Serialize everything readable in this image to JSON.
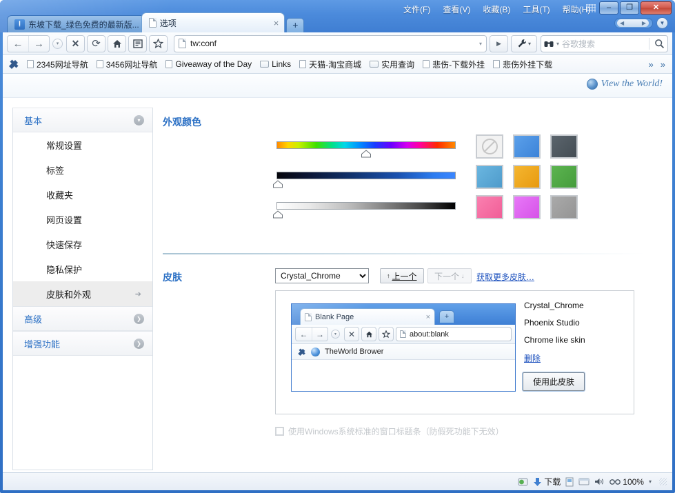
{
  "window": {
    "menus": [
      {
        "label": "文件(F)",
        "name": "menu-file"
      },
      {
        "label": "查看(V)",
        "name": "menu-view"
      },
      {
        "label": "收藏(B)",
        "name": "menu-favorites"
      },
      {
        "label": "工具(T)",
        "name": "menu-tools"
      },
      {
        "label": "帮助(H)",
        "name": "menu-help"
      }
    ],
    "controls": {
      "minimize": "–",
      "maximize": "❐",
      "close": "✕"
    }
  },
  "tabs": [
    {
      "label": "东坡下载_绿色免费的最新版...",
      "active": false,
      "icon": "tw-logo",
      "close": "×"
    },
    {
      "label": "选项",
      "active": true,
      "icon": "page-icon",
      "close": "×"
    }
  ],
  "new_tab_label": "+",
  "toolbar": {
    "back": "←",
    "forward": "→",
    "history_dropdown": "▾",
    "stop": "✕",
    "refresh": "⟳",
    "home": "⌂",
    "reader": "☰",
    "favorite": "☆",
    "address_value": "tw:conf",
    "address_dropdown": "▾",
    "go": "▶",
    "tools": "⚒",
    "tools_caret": "▾",
    "search_engine_icon": "☎",
    "search_caret": "▾",
    "search_placeholder": "谷歌搜索",
    "search_icon": "⌕"
  },
  "bookmarks": {
    "items": [
      {
        "label": "2345网址导航",
        "type": "doc"
      },
      {
        "label": "3456网址导航",
        "type": "doc"
      },
      {
        "label": "Giveaway of the Day",
        "type": "doc"
      },
      {
        "label": "Links",
        "type": "folder"
      },
      {
        "label": "天猫-淘宝商城",
        "type": "doc"
      },
      {
        "label": "实用查询",
        "type": "folder"
      },
      {
        "label": "悲伤-下载外挂",
        "type": "doc"
      },
      {
        "label": "悲伤外挂下载",
        "type": "doc"
      }
    ],
    "overflow1": "»",
    "overflow2": "»"
  },
  "brand": {
    "text": "View the World!"
  },
  "optnav": {
    "groups": [
      {
        "label": "基本",
        "name": "nav-group-basic",
        "expanded": true,
        "toggle_icon": "▾",
        "items": [
          {
            "label": "常规设置",
            "name": "sidebar-item-general",
            "selected": false
          },
          {
            "label": "标签",
            "name": "sidebar-item-tabs",
            "selected": false
          },
          {
            "label": "收藏夹",
            "name": "sidebar-item-favorites",
            "selected": false
          },
          {
            "label": "网页设置",
            "name": "sidebar-item-webpage",
            "selected": false
          },
          {
            "label": "快速保存",
            "name": "sidebar-item-quicksave",
            "selected": false
          },
          {
            "label": "隐私保护",
            "name": "sidebar-item-privacy",
            "selected": false
          },
          {
            "label": "皮肤和外观",
            "name": "sidebar-item-skin",
            "selected": true,
            "arrow": "➔"
          }
        ]
      },
      {
        "label": "高级",
        "name": "nav-group-advanced",
        "expanded": false,
        "toggle_icon": "❯",
        "items": []
      },
      {
        "label": "增强功能",
        "name": "nav-group-enhanced",
        "expanded": false,
        "toggle_icon": "❯",
        "items": []
      }
    ]
  },
  "appearance": {
    "title": "外观颜色",
    "sliders": [
      {
        "name": "hue-slider",
        "value_pct": 50
      },
      {
        "name": "luminance-slider",
        "value_pct": 1
      },
      {
        "name": "saturation-slider",
        "value_pct": 1
      }
    ],
    "swatches": [
      {
        "name": "swatch-none",
        "color": "none"
      },
      {
        "name": "swatch-blue",
        "color": "#4a90e2"
      },
      {
        "name": "swatch-dark-slate",
        "color": "#515a61"
      },
      {
        "name": "swatch-light-blue",
        "color": "#5ba8d6"
      },
      {
        "name": "swatch-orange",
        "color": "#efa81e"
      },
      {
        "name": "swatch-green",
        "color": "#4fa845"
      },
      {
        "name": "swatch-pink",
        "color": "#f76ea3"
      },
      {
        "name": "swatch-magenta",
        "color": "#e061f0"
      },
      {
        "name": "swatch-gray",
        "color": "#9d9d9d"
      }
    ]
  },
  "skin": {
    "title": "皮肤",
    "selected": "Crystal_Chrome",
    "options": [
      "Crystal_Chrome",
      "Phoenix Studio",
      "Chrome like skin"
    ],
    "prev_label": "上一个",
    "prev_icon": "↑",
    "next_label": "下一个",
    "next_icon": "↓",
    "more_link": "获取更多皮肤…",
    "list": [
      "Crystal_Chrome",
      "Phoenix Studio",
      "Chrome like skin"
    ],
    "delete_link": "删除",
    "use_button": "使用此皮肤",
    "preview": {
      "tab_title": "Blank Page",
      "tab_close": "×",
      "new_tab": "+",
      "address": "about:blank",
      "bookmark": "TheWorld Brower",
      "back": "←",
      "forward": "→",
      "drop": "▾",
      "stop": "✕",
      "home": "⌂",
      "favorite": "☆"
    },
    "win_titlebar_option": "使用Windows系统标准的窗口标题条（防假死功能下无效）"
  },
  "statusbar": {
    "items": [
      {
        "name": "status-proxy-icon",
        "icon": "◉",
        "label": ""
      },
      {
        "name": "status-download",
        "icon": "⬇",
        "label": "下载"
      },
      {
        "name": "status-save-icon",
        "icon": "▤",
        "label": ""
      },
      {
        "name": "status-window-icon",
        "icon": "▭",
        "label": ""
      },
      {
        "name": "status-sound-icon",
        "icon": "♪",
        "label": ""
      },
      {
        "name": "status-zoom",
        "icon": "⚭",
        "label": "100%"
      },
      {
        "name": "status-zoom-caret",
        "icon": "▾",
        "label": ""
      }
    ]
  }
}
